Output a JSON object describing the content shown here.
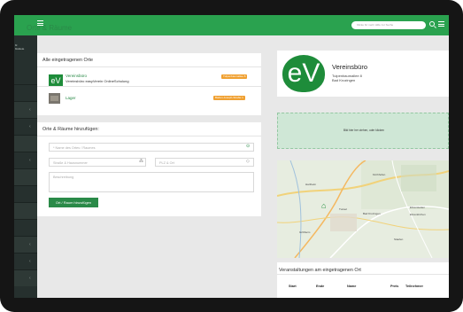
{
  "app": {
    "search_placeholder": "Klicke für mehr Hilfe zur Suche",
    "sidebar_lines": [
      "bl",
      "blokiete"
    ]
  },
  "page": {
    "title": "Orte & Räume"
  },
  "locations": {
    "title": "Alle eingetragenen Orte",
    "items": [
      {
        "name": "Vereinsbüro",
        "subtitle": "Vereinsbüro easyVerein OnlineSchulung",
        "badge": "Tulpenbaumallee 8"
      },
      {
        "name": "Lager",
        "subtitle": "",
        "badge": "Baden-Joseph-Straße 1"
      }
    ]
  },
  "add_form": {
    "title": "Orte & Räume hinzufügen:",
    "name_placeholder": "* Name des Ortes / Raumes",
    "street_placeholder": "Straße & Hausnummer",
    "zip_placeholder": "PLZ & Ort",
    "description_placeholder": "Beschreibung",
    "submit_label": "Ort / Raum hinzufügen"
  },
  "detail": {
    "logo_text": "eV",
    "name": "Vereinsbüro",
    "address_lines": [
      "Tulpenbaumallee 8",
      "Bad Krozingen"
    ],
    "image_drop_text": "Bild hier her ziehen, oder klicken"
  },
  "map": {
    "labels": [
      "Hartheim",
      "Kirchhofen",
      "Ehrenkirchen",
      "Bad Krozingen",
      "Ehrenstetten",
      "Staufen",
      "Tunsel",
      "Grißheim"
    ]
  },
  "events": {
    "title": "Veranstaltungen am eingetragenen Ort",
    "columns": [
      "Start",
      "Ende",
      "Name",
      "Preis",
      "Teilnehmer"
    ]
  },
  "colors": {
    "brand_green": "#2aa24f",
    "badge_orange": "#f0a030",
    "sidebar": "#26302e"
  }
}
